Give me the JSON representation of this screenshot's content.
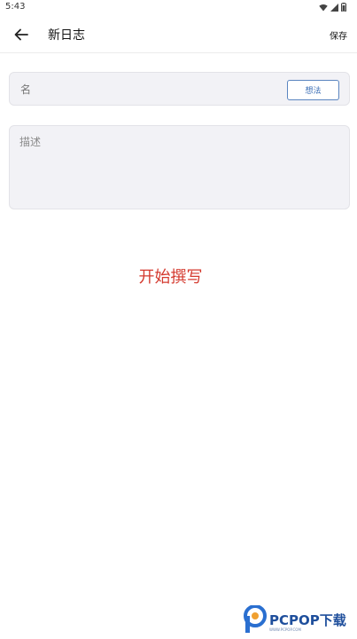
{
  "status_bar": {
    "time": "5:43"
  },
  "app_bar": {
    "title": "新日志",
    "save_label": "保存"
  },
  "form": {
    "name_placeholder": "名",
    "idea_button_label": "想法",
    "description_placeholder": "描述"
  },
  "start_writing_label": "开始撰写",
  "watermark": {
    "brand": "PCPOP下载",
    "subtitle": "WWW.PCPOP.COM"
  },
  "colors": {
    "accent": "#d43a2f",
    "button_border": "#5a85c0"
  }
}
